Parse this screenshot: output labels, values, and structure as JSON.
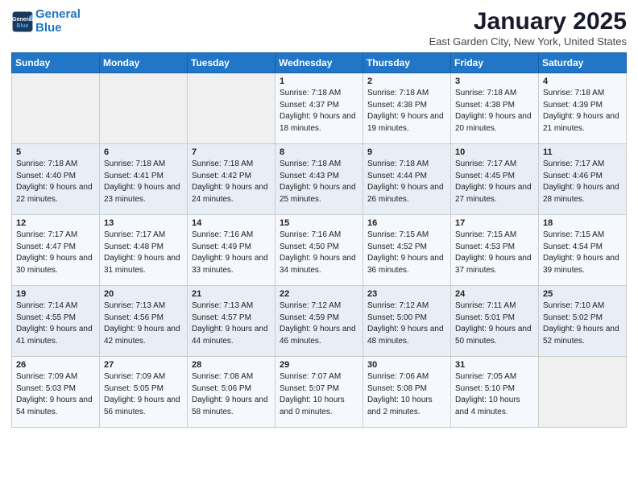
{
  "logo": {
    "line1": "General",
    "line2": "Blue"
  },
  "title": "January 2025",
  "location": "East Garden City, New York, United States",
  "weekdays": [
    "Sunday",
    "Monday",
    "Tuesday",
    "Wednesday",
    "Thursday",
    "Friday",
    "Saturday"
  ],
  "weeks": [
    [
      {
        "day": "",
        "sunrise": "",
        "sunset": "",
        "daylight": ""
      },
      {
        "day": "",
        "sunrise": "",
        "sunset": "",
        "daylight": ""
      },
      {
        "day": "",
        "sunrise": "",
        "sunset": "",
        "daylight": ""
      },
      {
        "day": "1",
        "sunrise": "7:18 AM",
        "sunset": "4:37 PM",
        "daylight": "9 hours and 18 minutes."
      },
      {
        "day": "2",
        "sunrise": "7:18 AM",
        "sunset": "4:38 PM",
        "daylight": "9 hours and 19 minutes."
      },
      {
        "day": "3",
        "sunrise": "7:18 AM",
        "sunset": "4:38 PM",
        "daylight": "9 hours and 20 minutes."
      },
      {
        "day": "4",
        "sunrise": "7:18 AM",
        "sunset": "4:39 PM",
        "daylight": "9 hours and 21 minutes."
      }
    ],
    [
      {
        "day": "5",
        "sunrise": "7:18 AM",
        "sunset": "4:40 PM",
        "daylight": "9 hours and 22 minutes."
      },
      {
        "day": "6",
        "sunrise": "7:18 AM",
        "sunset": "4:41 PM",
        "daylight": "9 hours and 23 minutes."
      },
      {
        "day": "7",
        "sunrise": "7:18 AM",
        "sunset": "4:42 PM",
        "daylight": "9 hours and 24 minutes."
      },
      {
        "day": "8",
        "sunrise": "7:18 AM",
        "sunset": "4:43 PM",
        "daylight": "9 hours and 25 minutes."
      },
      {
        "day": "9",
        "sunrise": "7:18 AM",
        "sunset": "4:44 PM",
        "daylight": "9 hours and 26 minutes."
      },
      {
        "day": "10",
        "sunrise": "7:17 AM",
        "sunset": "4:45 PM",
        "daylight": "9 hours and 27 minutes."
      },
      {
        "day": "11",
        "sunrise": "7:17 AM",
        "sunset": "4:46 PM",
        "daylight": "9 hours and 28 minutes."
      }
    ],
    [
      {
        "day": "12",
        "sunrise": "7:17 AM",
        "sunset": "4:47 PM",
        "daylight": "9 hours and 30 minutes."
      },
      {
        "day": "13",
        "sunrise": "7:17 AM",
        "sunset": "4:48 PM",
        "daylight": "9 hours and 31 minutes."
      },
      {
        "day": "14",
        "sunrise": "7:16 AM",
        "sunset": "4:49 PM",
        "daylight": "9 hours and 33 minutes."
      },
      {
        "day": "15",
        "sunrise": "7:16 AM",
        "sunset": "4:50 PM",
        "daylight": "9 hours and 34 minutes."
      },
      {
        "day": "16",
        "sunrise": "7:15 AM",
        "sunset": "4:52 PM",
        "daylight": "9 hours and 36 minutes."
      },
      {
        "day": "17",
        "sunrise": "7:15 AM",
        "sunset": "4:53 PM",
        "daylight": "9 hours and 37 minutes."
      },
      {
        "day": "18",
        "sunrise": "7:15 AM",
        "sunset": "4:54 PM",
        "daylight": "9 hours and 39 minutes."
      }
    ],
    [
      {
        "day": "19",
        "sunrise": "7:14 AM",
        "sunset": "4:55 PM",
        "daylight": "9 hours and 41 minutes."
      },
      {
        "day": "20",
        "sunrise": "7:13 AM",
        "sunset": "4:56 PM",
        "daylight": "9 hours and 42 minutes."
      },
      {
        "day": "21",
        "sunrise": "7:13 AM",
        "sunset": "4:57 PM",
        "daylight": "9 hours and 44 minutes."
      },
      {
        "day": "22",
        "sunrise": "7:12 AM",
        "sunset": "4:59 PM",
        "daylight": "9 hours and 46 minutes."
      },
      {
        "day": "23",
        "sunrise": "7:12 AM",
        "sunset": "5:00 PM",
        "daylight": "9 hours and 48 minutes."
      },
      {
        "day": "24",
        "sunrise": "7:11 AM",
        "sunset": "5:01 PM",
        "daylight": "9 hours and 50 minutes."
      },
      {
        "day": "25",
        "sunrise": "7:10 AM",
        "sunset": "5:02 PM",
        "daylight": "9 hours and 52 minutes."
      }
    ],
    [
      {
        "day": "26",
        "sunrise": "7:09 AM",
        "sunset": "5:03 PM",
        "daylight": "9 hours and 54 minutes."
      },
      {
        "day": "27",
        "sunrise": "7:09 AM",
        "sunset": "5:05 PM",
        "daylight": "9 hours and 56 minutes."
      },
      {
        "day": "28",
        "sunrise": "7:08 AM",
        "sunset": "5:06 PM",
        "daylight": "9 hours and 58 minutes."
      },
      {
        "day": "29",
        "sunrise": "7:07 AM",
        "sunset": "5:07 PM",
        "daylight": "10 hours and 0 minutes."
      },
      {
        "day": "30",
        "sunrise": "7:06 AM",
        "sunset": "5:08 PM",
        "daylight": "10 hours and 2 minutes."
      },
      {
        "day": "31",
        "sunrise": "7:05 AM",
        "sunset": "5:10 PM",
        "daylight": "10 hours and 4 minutes."
      },
      {
        "day": "",
        "sunrise": "",
        "sunset": "",
        "daylight": ""
      }
    ]
  ],
  "labels": {
    "sunrise": "Sunrise:",
    "sunset": "Sunset:",
    "daylight": "Daylight:"
  }
}
